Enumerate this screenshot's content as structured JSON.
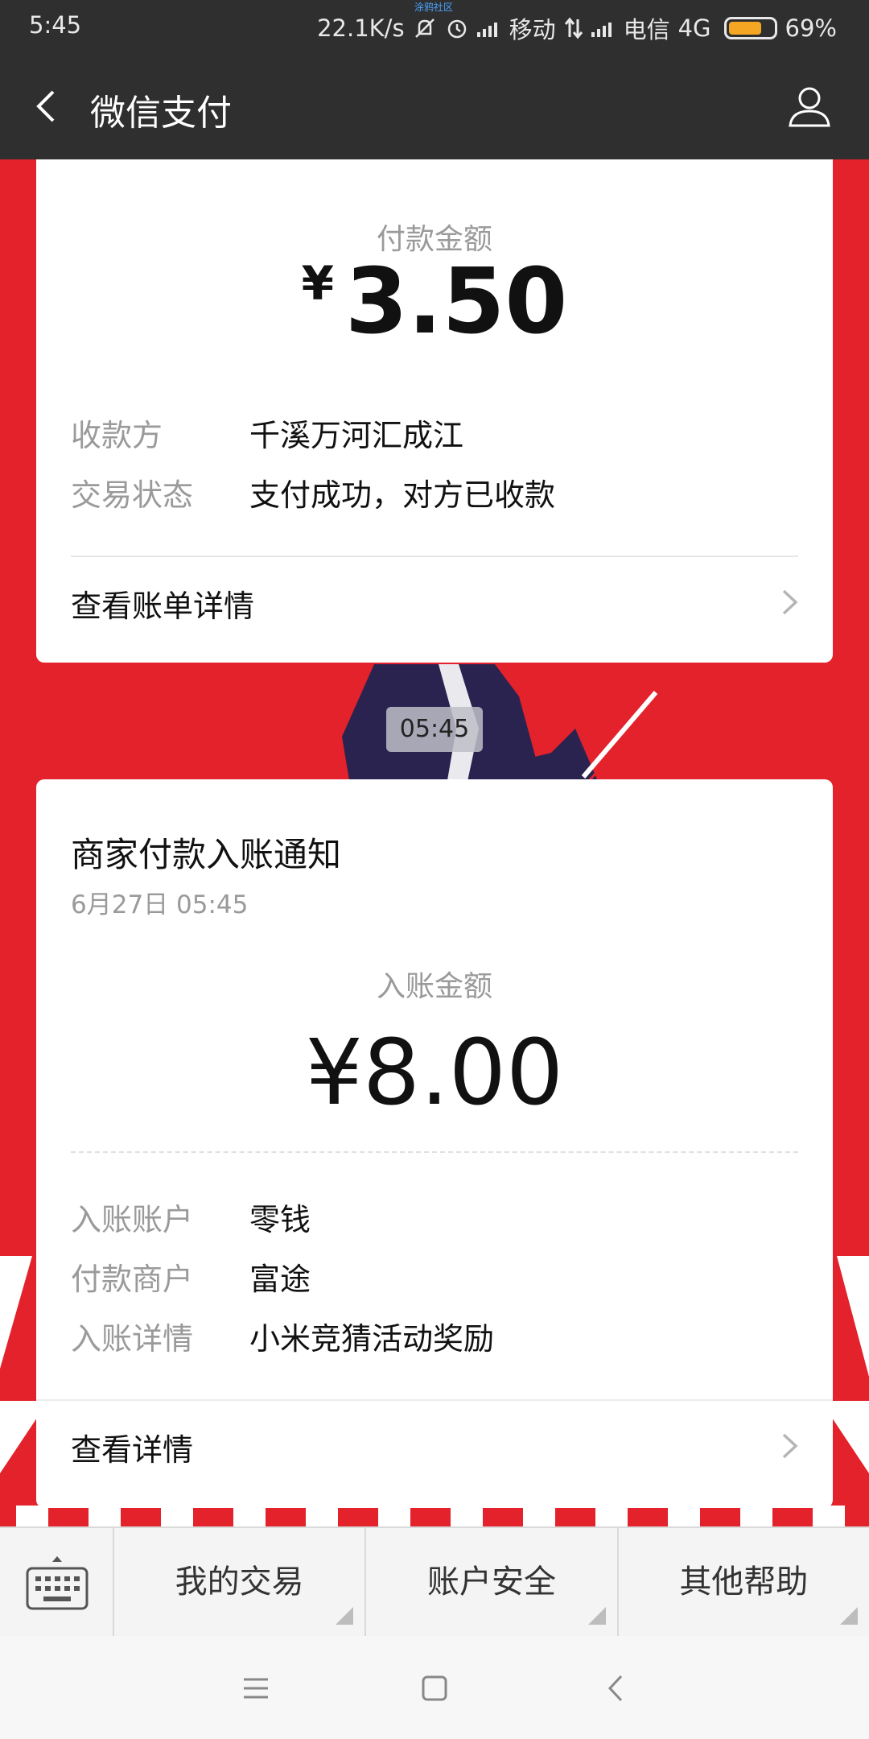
{
  "status_bar": {
    "time": "5:45",
    "net_speed": "22.1K/s",
    "carrier1": "移动",
    "carrier2": "电信",
    "network": "4G",
    "battery": "69%",
    "watermark": "涂鸦社区"
  },
  "header": {
    "title": "微信支付"
  },
  "card1": {
    "amount_label": "付款金额",
    "currency": "¥",
    "amount": "3.50",
    "rows": [
      {
        "key": "收款方",
        "value": "千溪万河汇成江"
      },
      {
        "key": "交易状态",
        "value": "支付成功，对方已收款"
      }
    ],
    "link": "查看账单详情"
  },
  "timestamp": "05:45",
  "card2": {
    "title": "商家付款入账通知",
    "date": "6月27日  05:45",
    "amount_label": "入账金额",
    "amount": "¥8.00",
    "rows": [
      {
        "key": "入账账户",
        "value": "零钱"
      },
      {
        "key": "付款商户",
        "value": "富途"
      },
      {
        "key": "入账详情",
        "value": "小米竞猜活动奖励"
      }
    ],
    "link": "查看详情"
  },
  "menu": {
    "items": [
      "我的交易",
      "账户安全",
      "其他帮助"
    ]
  },
  "colors": {
    "background_red": "#e3222b",
    "bar_dark": "#2f2f2f",
    "battery_fill": "#f5a623"
  }
}
